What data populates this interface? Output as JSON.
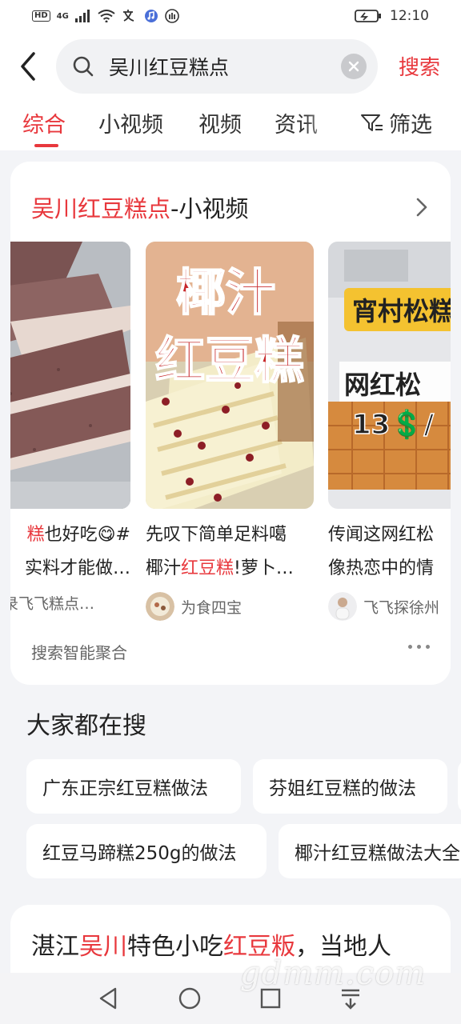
{
  "status_bar": {
    "hd": "HD",
    "network": "4G",
    "time": "12:10"
  },
  "search": {
    "query": "吴川红豆糕点",
    "button": "搜索"
  },
  "tabs": [
    "综合",
    "小视频",
    "视频",
    "资讯"
  ],
  "filter_label": "筛选",
  "video_section": {
    "title_highlight": "吴川红豆糕点",
    "title_rest": "-小视频",
    "videos": [
      {
        "line1_hl": "糕",
        "line1_rest": "也好吃😋#",
        "line2": "实料才能做…",
        "author": "寻录飞飞糕点…"
      },
      {
        "overlay_line1": "椰汁",
        "overlay_line2": "红豆糕",
        "line1": "先叹下简单足料噶",
        "line2_pre": "椰汁",
        "line2_hl": "红豆糕",
        "line2_post": "!萝卜…",
        "author": "为食四宝"
      },
      {
        "overlay_top": "宵村松糕",
        "overlay_mid": "网红松",
        "overlay_price": "13💲/",
        "line1": "传闻这网红松",
        "line2": "像热恋中的情",
        "author": "飞飞探徐州"
      }
    ],
    "aggregate_label": "搜索智能聚合"
  },
  "popular": {
    "title": "大家都在搜",
    "chips": [
      "广东正宗红豆糕做法",
      "芬姐红豆糕的做法",
      "红豆马蹄糕250g的做法",
      "椰汁红豆糕做法大全"
    ]
  },
  "article": {
    "p1": "湛江",
    "p2": "吴川",
    "p3": "特色小吃",
    "p4": "红豆粄",
    "p5": "，当地人"
  },
  "watermark": "gdmm.com",
  "colors": {
    "accent": "#e8383d",
    "background": "#f3f4f7"
  },
  "icons": [
    "back-arrow-icon",
    "search-icon",
    "clear-icon",
    "filter-icon",
    "chevron-right-icon",
    "more-icon",
    "nav-back-icon",
    "nav-home-icon",
    "nav-recent-icon",
    "nav-menu-icon"
  ]
}
